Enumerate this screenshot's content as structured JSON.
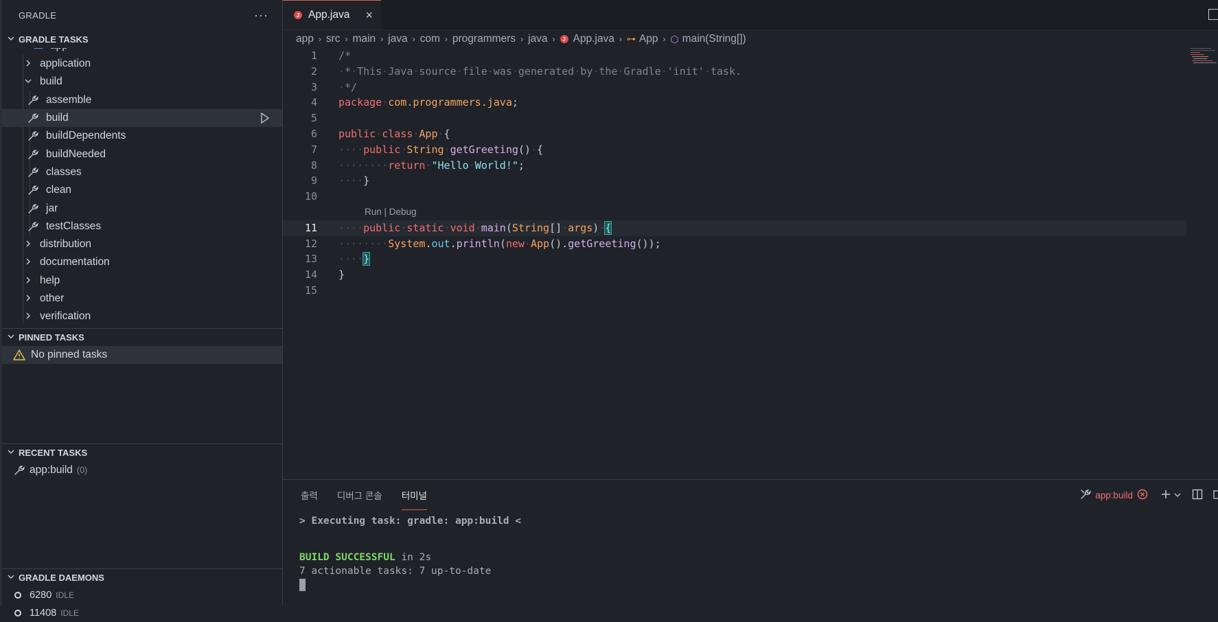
{
  "sidebar": {
    "title": "GRADLE",
    "tasks_header": "GRADLE TASKS",
    "project_label": "app",
    "tree": [
      {
        "label": "application",
        "type": "group",
        "expanded": false
      },
      {
        "label": "build",
        "type": "group",
        "expanded": true
      },
      {
        "label": "assemble",
        "type": "task"
      },
      {
        "label": "build",
        "type": "task",
        "selected": true
      },
      {
        "label": "buildDependents",
        "type": "task"
      },
      {
        "label": "buildNeeded",
        "type": "task"
      },
      {
        "label": "classes",
        "type": "task"
      },
      {
        "label": "clean",
        "type": "task"
      },
      {
        "label": "jar",
        "type": "task"
      },
      {
        "label": "testClasses",
        "type": "task"
      },
      {
        "label": "distribution",
        "type": "group",
        "expanded": false
      },
      {
        "label": "documentation",
        "type": "group",
        "expanded": false
      },
      {
        "label": "help",
        "type": "group",
        "expanded": false
      },
      {
        "label": "other",
        "type": "group",
        "expanded": false
      },
      {
        "label": "verification",
        "type": "group",
        "expanded": false
      }
    ],
    "pinned_header": "PINNED TASKS",
    "pinned_empty": "No pinned tasks",
    "recent_header": "RECENT TASKS",
    "recent_task": "app:build",
    "recent_count": "(0)",
    "daemons_header": "GRADLE DAEMONS",
    "daemons": [
      {
        "pid": "6280",
        "status": "IDLE"
      },
      {
        "pid": "11408",
        "status": "IDLE"
      }
    ]
  },
  "editor": {
    "tab_label": "App.java",
    "breadcrumbs": [
      "app",
      "src",
      "main",
      "java",
      "com",
      "programmers",
      "java",
      "App.java",
      "App",
      "main(String[])"
    ],
    "codelens": "Run | Debug",
    "line_numbers": [
      "1",
      "2",
      "3",
      "4",
      "5",
      "6",
      "7",
      "8",
      "9",
      "10",
      "11",
      "12",
      "13",
      "14",
      "15"
    ]
  },
  "panel": {
    "tabs": [
      "출력",
      "디버그 콘솔",
      "터미널"
    ],
    "active_tab": "터미널",
    "task_label": "app:build",
    "terminal": {
      "line1": "> Executing task: gradle: app:build <",
      "success": "BUILD SUCCESSFUL",
      "success_rest": " in 2s",
      "line3": "7 actionable tasks: 7 up-to-date"
    }
  },
  "colors": {
    "accent": "#e0604a",
    "background": "#1f2228",
    "success": "#7ed86a"
  }
}
